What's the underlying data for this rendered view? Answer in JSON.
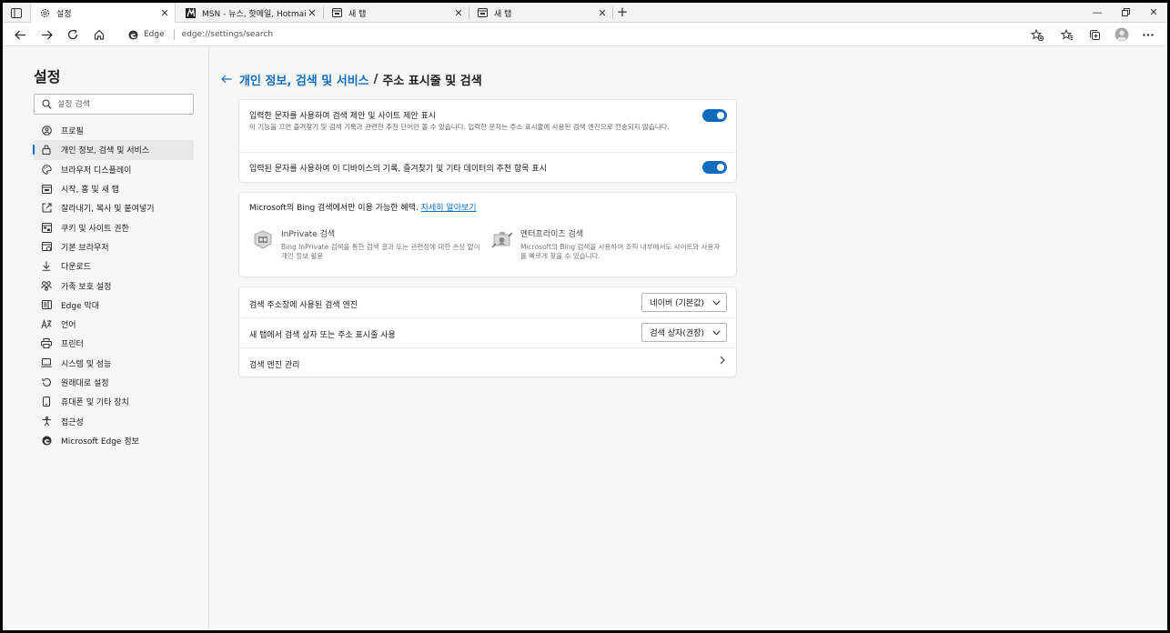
{
  "tabs": [
    {
      "title": "설정",
      "icon": "gear-icon",
      "active": true
    },
    {
      "title": "MSN - 뉴스, 핫메일, Hotmail, Sk",
      "icon": "msn-icon",
      "active": false
    },
    {
      "title": "새 탭",
      "icon": "new-tab-page-icon",
      "active": false
    },
    {
      "title": "새 탭",
      "icon": "new-tab-page-icon",
      "active": false
    }
  ],
  "toolbar": {
    "site_chip": "Edge",
    "url": "edge://settings/search"
  },
  "sidebar": {
    "title": "설정",
    "search_placeholder": "설정 검색",
    "items": [
      {
        "label": "프로필",
        "icon": "profile-icon"
      },
      {
        "label": "개인 정보, 검색 및 서비스",
        "icon": "lock-icon",
        "selected": true
      },
      {
        "label": "브라우저 디스플레이",
        "icon": "palette-icon"
      },
      {
        "label": "시작, 홈 및 새 탭",
        "icon": "home-tab-icon"
      },
      {
        "label": "잘라내기, 복사 및 붙여넣기",
        "icon": "clipboard-icon"
      },
      {
        "label": "쿠키 및 사이트 권한",
        "icon": "cookie-icon"
      },
      {
        "label": "기본 브라우저",
        "icon": "browser-icon"
      },
      {
        "label": "다운로드",
        "icon": "download-icon"
      },
      {
        "label": "가족 보호 설정",
        "icon": "family-icon"
      },
      {
        "label": "Edge 막대",
        "icon": "edge-bar-icon"
      },
      {
        "label": "언어",
        "icon": "language-icon"
      },
      {
        "label": "프린터",
        "icon": "printer-icon"
      },
      {
        "label": "시스템 및 성능",
        "icon": "laptop-icon"
      },
      {
        "label": "원래대로 설정",
        "icon": "reset-icon"
      },
      {
        "label": "휴대폰 및 기타 장치",
        "icon": "phone-icon"
      },
      {
        "label": "접근성",
        "icon": "accessibility-icon"
      },
      {
        "label": "Microsoft Edge 정보",
        "icon": "edge-logo-icon"
      }
    ]
  },
  "breadcrumb": {
    "parent": "개인 정보, 검색 및 서비스",
    "separator": "/",
    "current": "주소 표시줄 및 검색"
  },
  "suggestions": {
    "row1_title": "입력한 문자를 사용하여 검색 제안 및 사이트 제안 표시",
    "row1_desc": "이 기능을 끄면 즐겨찾기 및 검색 기록과 관련한 추천 단어만 볼 수 있습니다. 입력한 문자는 주소 표시줄에 사용된 검색 엔진으로 전송되지 않습니다.",
    "row1_on": true,
    "row2_title": "입력된 문자를 사용하여 이 디바이스의 기록, 즐겨찾기 및 기타 데이터의 추천 항목 표시",
    "row2_on": true
  },
  "bing": {
    "heading": "Microsoft의 Bing 검색에서만 이용 가능한 혜택.",
    "link": "자세히 알아보기",
    "inprivate_title": "InPrivate 검색",
    "inprivate_desc": "Bing InPrivate 검색을 통한 검색 결과 또는 관련성에 대한 손상 없이 개인 정보 활용",
    "enterprise_title": "엔터프라이즈 검색",
    "enterprise_desc": "Microsoft의 Bing 검색을 사용하여 조직 내부에서도 사이트와 사용자를 빠르게 찾을 수 있습니다."
  },
  "engine": {
    "row1_label": "검색 주소창에 사용된 검색 엔진",
    "row1_value": "네이버 (기본값)",
    "row2_label": "새 탭에서 검색 상자 또는 주소 표시줄 사용",
    "row2_value": "검색 상자(권장)",
    "row3_label": "검색 엔진 관리"
  },
  "colors": {
    "accent": "#0f6cbd",
    "page_bg": "#f7f7f7",
    "card_bg": "#ffffff"
  }
}
